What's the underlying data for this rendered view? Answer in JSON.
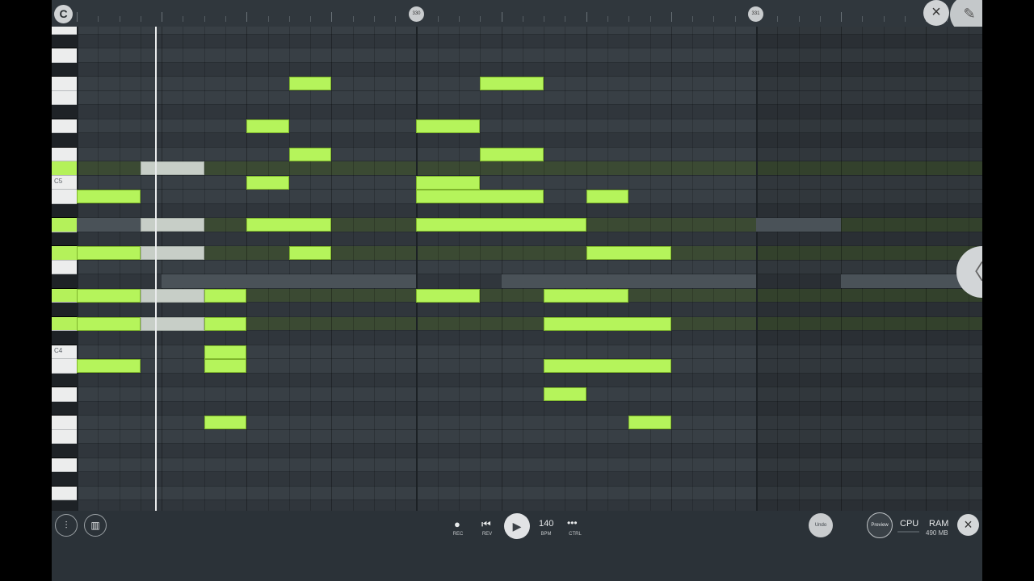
{
  "ruler": {
    "logo": "C",
    "bar_markers": [
      "330",
      "331"
    ],
    "close_glyph": "×",
    "corner_glyph": "✎"
  },
  "keyboard": {
    "label_c5": "C5",
    "label_c4": "C4"
  },
  "side_handle": {
    "glyph": "〈"
  },
  "toolbar": {
    "mixer_glyph": "⫶",
    "piano_glyph": "▥",
    "rec_glyph": "●",
    "rec_label": "REC",
    "rev_glyph": "⏮",
    "rev_label": "REV",
    "play_glyph": "▶",
    "bpm_value": "140",
    "bpm_label": "BPM",
    "ctrl_glyph": "•••",
    "ctrl_label": "CTRL",
    "undo_label": "Undo",
    "preview_label": "Preview",
    "cpu_label": "CPU",
    "ram_label": "RAM",
    "ram_value": "490 MB",
    "close_glyph": "×"
  },
  "colors": {
    "note": "#b5f45b",
    "ghost_note": "#cfd6cf",
    "grid_bg": "#383f45",
    "active_key": "#b4f15a"
  },
  "notes": [
    {
      "row": 4,
      "start": 10,
      "len": 2
    },
    {
      "row": 4,
      "start": 19,
      "len": 3
    },
    {
      "row": 7,
      "start": 8,
      "len": 2
    },
    {
      "row": 7,
      "start": 16,
      "len": 3
    },
    {
      "row": 9,
      "start": 10,
      "len": 2
    },
    {
      "row": 9,
      "start": 19,
      "len": 3
    },
    {
      "row": 11,
      "start": 8,
      "len": 2
    },
    {
      "row": 11,
      "start": 16,
      "len": 3
    },
    {
      "row": 12,
      "start": 0,
      "len": 3
    },
    {
      "row": 12,
      "start": 16,
      "len": 6
    },
    {
      "row": 12,
      "start": 24,
      "len": 2
    },
    {
      "row": 14,
      "start": 8,
      "len": 4
    },
    {
      "row": 14,
      "start": 16,
      "len": 8
    },
    {
      "row": 16,
      "start": 0,
      "len": 3
    },
    {
      "row": 16,
      "start": 10,
      "len": 2
    },
    {
      "row": 16,
      "start": 24,
      "len": 4
    },
    {
      "row": 19,
      "start": 0,
      "len": 3
    },
    {
      "row": 19,
      "start": 6,
      "len": 2
    },
    {
      "row": 19,
      "start": 16,
      "len": 3
    },
    {
      "row": 19,
      "start": 22,
      "len": 4
    },
    {
      "row": 21,
      "start": 0,
      "len": 3
    },
    {
      "row": 21,
      "start": 6,
      "len": 2
    },
    {
      "row": 21,
      "start": 22,
      "len": 6
    },
    {
      "row": 23,
      "start": 6,
      "len": 2
    },
    {
      "row": 24,
      "start": 0,
      "len": 3
    },
    {
      "row": 24,
      "start": 6,
      "len": 2
    },
    {
      "row": 24,
      "start": 22,
      "len": 6
    },
    {
      "row": 26,
      "start": 22,
      "len": 2
    },
    {
      "row": 28,
      "start": 6,
      "len": 2
    },
    {
      "row": 28,
      "start": 26,
      "len": 2
    }
  ],
  "ghost_notes": [
    {
      "row": 10,
      "start": 3,
      "len": 3
    },
    {
      "row": 14,
      "start": 3,
      "len": 3
    },
    {
      "row": 16,
      "start": 3,
      "len": 3
    },
    {
      "row": 19,
      "start": 3,
      "len": 3
    },
    {
      "row": 21,
      "start": 3,
      "len": 3
    }
  ],
  "dim_notes": [
    {
      "row": 14,
      "start": 0,
      "len": 3
    },
    {
      "row": 14,
      "start": 32,
      "len": 4
    },
    {
      "row": 18,
      "start": 4,
      "len": 12
    },
    {
      "row": 18,
      "start": 20,
      "len": 12
    },
    {
      "row": 18,
      "start": 36,
      "len": 7
    }
  ],
  "active_keys": [
    10,
    14,
    16,
    19,
    21
  ]
}
